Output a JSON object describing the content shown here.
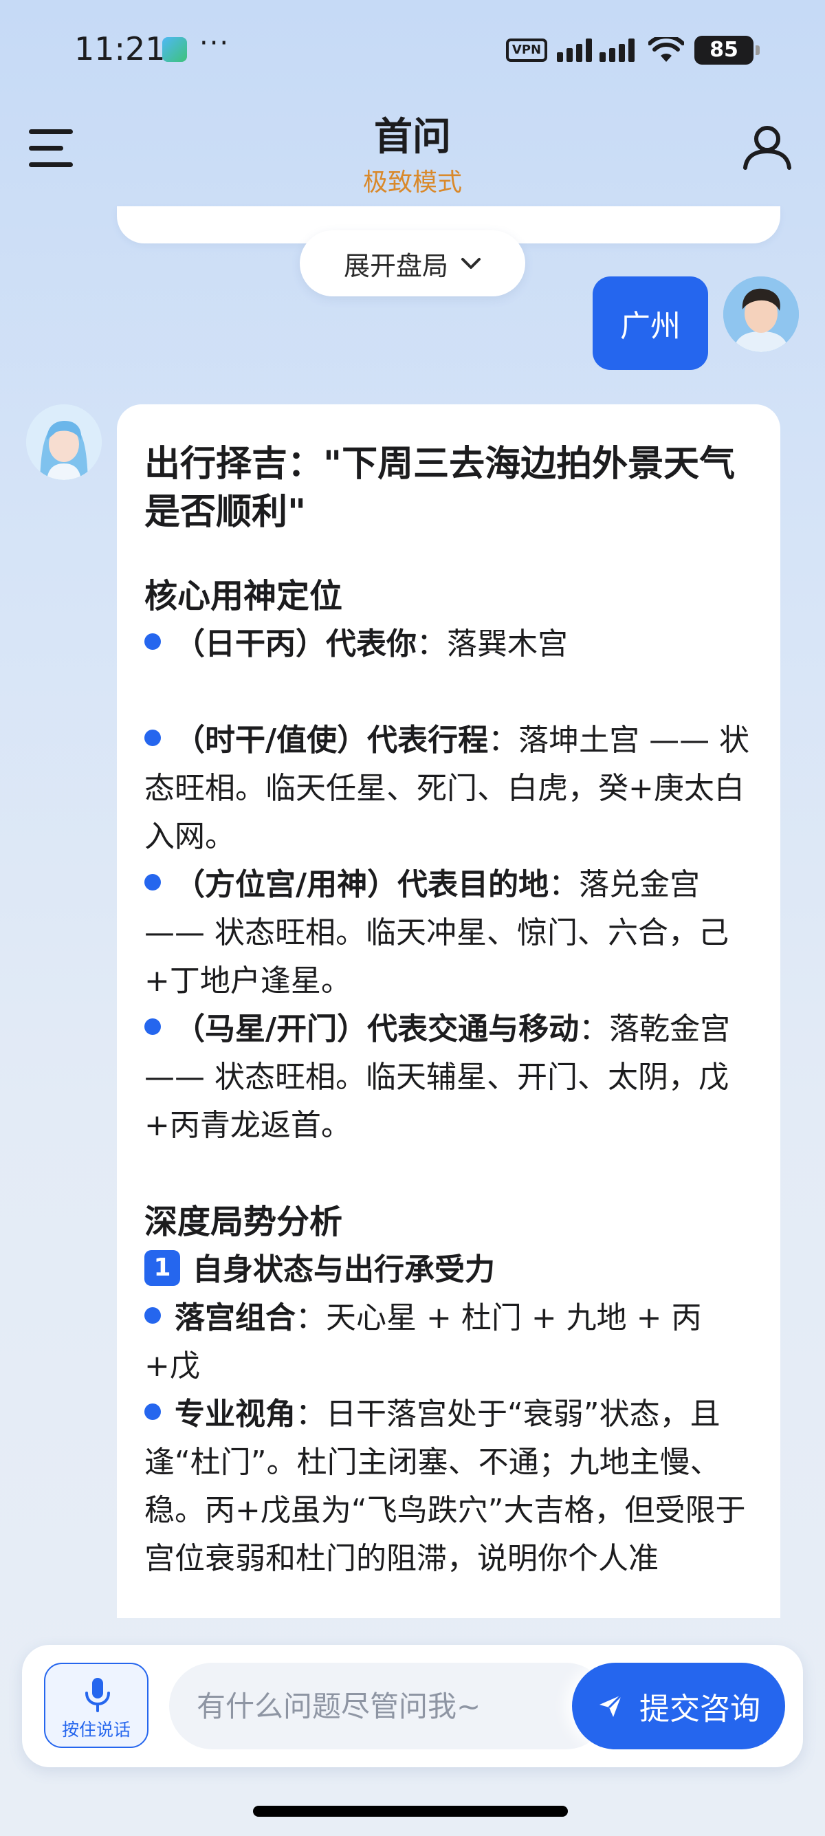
{
  "status_bar": {
    "time": "11:21",
    "more": "···",
    "vpn": "VPN",
    "battery": "85"
  },
  "header": {
    "title": "首问",
    "subtitle": "极致模式"
  },
  "expand_label": "展开盘局",
  "user_message": "广州",
  "bot_message": {
    "title": "出行择吉：\"下周三去海边拍外景天气是否顺利\"",
    "section1_heading": "核心用神定位",
    "b1_bold": "（日干丙）代表你",
    "b1_text": "：落巽木宫",
    "b2_bold": "（时干/值使）代表行程",
    "b2_text": "：落坤土宫 —— 状态旺相。临天任星、死门、白虎，癸+庚太白入网。",
    "b3_bold": "（方位宫/用神）代表目的地",
    "b3_text": "：落兑金宫 —— 状态旺相。临天冲星、惊门、六合，己+丁地户逢星。",
    "b4_bold": "（马星/开门）代表交通与移动",
    "b4_text": "：落乾金宫 —— 状态旺相。临天辅星、开门、太阴，戊+丙青龙返首。",
    "section2_heading": "深度局势分析",
    "sub1_number": "1",
    "sub1_heading": "自身状态与出行承受力",
    "b5_bold": "落宫组合",
    "b5_text": "：天心星 + 杜门 + 九地 + 丙+戊",
    "b6_bold": "专业视角",
    "b6_text": "：日干落宫处于“衰弱”状态，且逢“杜门”。杜门主闭塞、不通；九地主慢、稳。丙+戊虽为“飞鸟跌穴”大吉格，但受限于宫位衰弱和杜门的阻滞，说明你个人准"
  },
  "input": {
    "voice_label": "按住说话",
    "placeholder": "有什么问题尽管问我~",
    "submit_label": "提交咨询"
  },
  "colors": {
    "accent": "#2566ee",
    "subtitle": "#d9892b"
  }
}
